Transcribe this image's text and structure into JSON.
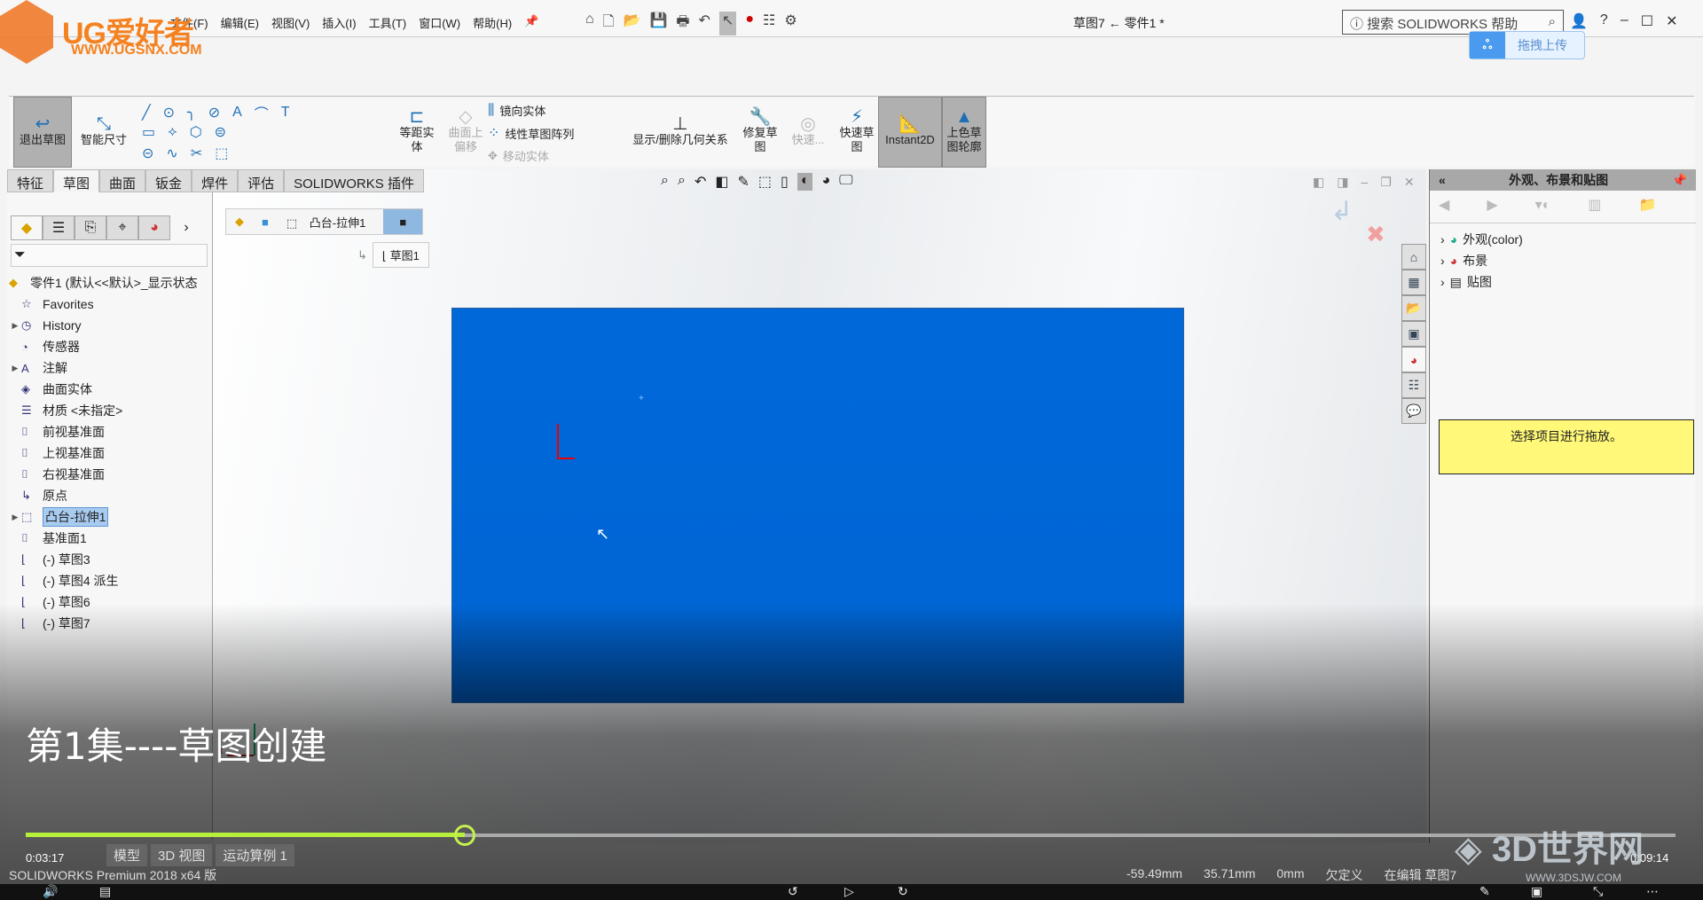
{
  "titlebar": {
    "menus": [
      "文件(F)",
      "编辑(E)",
      "视图(V)",
      "插入(I)",
      "工具(T)",
      "窗口(W)",
      "帮助(H)"
    ],
    "doc_title": "草图7 ← 零件1 *",
    "search_placeholder": "搜索 SOLIDWORKS 帮助",
    "upload_label": "拖拽上传"
  },
  "logo": {
    "text": "UG爱好者",
    "url": "WWW.UGSNX.COM"
  },
  "commandmanager": {
    "exit_sketch": "退出草图",
    "smart_dim": "智能尺寸",
    "offset": "等距实体",
    "offset_surface": "曲面上偏移",
    "mirror": "镜向实体",
    "linear_pattern": "线性草图阵列",
    "move": "移动实体",
    "relations": "显示/删除几何关系",
    "repair": "修复草图",
    "quick_snaps": "快速...",
    "rapid_sketch": "快速草图",
    "instant2d": "Instant2D",
    "shaded": "上色草图轮廓"
  },
  "tabs": [
    {
      "label": "特征"
    },
    {
      "label": "草图",
      "active": true
    },
    {
      "label": "曲面"
    },
    {
      "label": "钣金"
    },
    {
      "label": "焊件"
    },
    {
      "label": "评估"
    },
    {
      "label": "SOLIDWORKS 插件"
    }
  ],
  "tree": {
    "root": "零件1 (默认<<默认>_显示状态",
    "items": [
      {
        "label": "Favorites",
        "icon": "star-folder-icon",
        "expand": false
      },
      {
        "label": "History",
        "icon": "history-folder-icon",
        "expand": true
      },
      {
        "label": "传感器",
        "icon": "sensor-folder-icon",
        "expand": false
      },
      {
        "label": "注解",
        "icon": "annotation-folder-icon",
        "expand": true
      },
      {
        "label": "曲面实体",
        "icon": "surface-folder-icon",
        "expand": false
      },
      {
        "label": "材质 <未指定>",
        "icon": "material-icon",
        "expand": false
      },
      {
        "label": "前视基准面",
        "icon": "plane-icon",
        "expand": false
      },
      {
        "label": "上视基准面",
        "icon": "plane-icon",
        "expand": false
      },
      {
        "label": "右视基准面",
        "icon": "plane-icon",
        "expand": false
      },
      {
        "label": "原点",
        "icon": "origin-icon",
        "expand": false
      },
      {
        "label": "凸台-拉伸1",
        "icon": "extrude-icon",
        "expand": true,
        "selected": true
      },
      {
        "label": "基准面1",
        "icon": "plane-icon",
        "expand": false
      },
      {
        "label": "(-) 草图3",
        "icon": "sketch-icon",
        "expand": false
      },
      {
        "label": "(-) 草图4 派生",
        "icon": "sketch-icon",
        "expand": false
      },
      {
        "label": "(-) 草图6",
        "icon": "sketch-icon",
        "expand": false
      },
      {
        "label": "(-) 草图7",
        "icon": "sketch-icon",
        "expand": false
      }
    ]
  },
  "viewport": {
    "breadcrumb": "凸台-拉伸1",
    "sketch_crumb": "草图1",
    "sketch_color": "#0066d6"
  },
  "right_panel": {
    "title": "外观、布景和贴图",
    "items": [
      "外观(color)",
      "布景",
      "贴图"
    ],
    "hint": "选择项目进行拖放。"
  },
  "video": {
    "episode_title": "第1集----草图创建",
    "current_time": "0:03:17",
    "total_time": "0:09:14",
    "progress_percent": 35.6,
    "accent": "#b6f03c"
  },
  "bottom_tabs": [
    "模型",
    "3D 视图",
    "运动算例 1"
  ],
  "status": {
    "product": "SOLIDWORKS Premium 2018 x64 版",
    "x": "-59.49mm",
    "y": "35.71mm",
    "z": "0mm",
    "state": "欠定义",
    "editing": "在编辑 草图7"
  },
  "watermark": {
    "text": "3D世界网",
    "url": "WWW.3DSJW.COM"
  }
}
